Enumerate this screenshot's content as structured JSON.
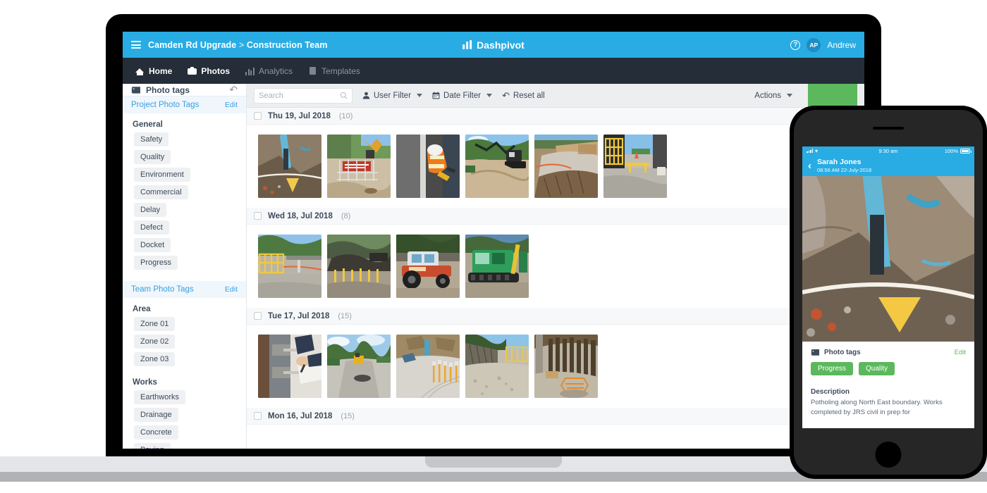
{
  "colors": {
    "brand_blue": "#28ace3",
    "nav_dark": "#242d38",
    "green": "#5cb85c",
    "link_blue": "#3b9ede",
    "text_dark": "#3d4b5c"
  },
  "desktop": {
    "topbar": {
      "menu_icon": "hamburger-icon",
      "breadcrumb_project": "Camden Rd Upgrade",
      "breadcrumb_separator": ">",
      "breadcrumb_team": "Construction Team",
      "brand": "Dashpivot",
      "help_icon": "help-icon",
      "avatar_initials": "AP",
      "user_name": "Andrew"
    },
    "nav": [
      {
        "label": "Home",
        "icon": "home-icon",
        "active": false
      },
      {
        "label": "Photos",
        "icon": "camera-icon",
        "active": true
      },
      {
        "label": "Analytics",
        "icon": "analytics-icon",
        "active": false
      },
      {
        "label": "Templates",
        "icon": "document-icon",
        "active": false
      }
    ],
    "sidebar": {
      "title": "Photo tags",
      "tag_icon": "tag-icon",
      "reset_icon": "undo-icon",
      "sections": [
        {
          "title": "Project Photo Tags",
          "edit_label": "Edit",
          "groups": [
            {
              "label": "General",
              "tags": [
                "Safety",
                "Quality",
                "Environment",
                "Commercial",
                "Delay",
                "Defect",
                "Docket",
                "Progress"
              ]
            }
          ]
        },
        {
          "title": "Team Photo Tags",
          "edit_label": "Edit",
          "groups": [
            {
              "label": "Area",
              "tags": [
                "Zone 01",
                "Zone 02",
                "Zone 03"
              ]
            },
            {
              "label": "Works",
              "tags": [
                "Earthworks",
                "Drainage",
                "Concrete",
                "Paving"
              ]
            }
          ]
        }
      ]
    },
    "toolbar": {
      "search_placeholder": "Search",
      "search_value": "",
      "search_icon": "search-icon",
      "user_filter_label": "User Filter",
      "user_filter_icon": "user-icon",
      "date_filter_label": "Date Filter",
      "date_filter_icon": "calendar-icon",
      "reset_all_label": "Reset all",
      "reset_all_icon": "undo-icon",
      "actions_label": "Actions"
    },
    "photo_groups": [
      {
        "date": "Thu 19, Jul 2018",
        "count": "(10)",
        "thumbs": [
          "trench-pipe",
          "excavator-fence",
          "worker-orange",
          "excavator-dirt",
          "road-embankment",
          "yellow-barrier"
        ]
      },
      {
        "date": "Wed 18, Jul 2018",
        "count": "(8)",
        "thumbs": [
          "yellow-fence-road",
          "stockpile-site",
          "loader-machine",
          "green-excavator"
        ]
      },
      {
        "date": "Tue 17, Jul 2018",
        "count": "(15)",
        "thumbs": [
          "desk-inspection",
          "road-paving",
          "rock-cut-site",
          "embankment-road",
          "timber-piles"
        ]
      },
      {
        "date": "Mon 16, Jul 2018",
        "count": "(15)",
        "thumbs": []
      }
    ]
  },
  "phone": {
    "status": {
      "time": "9:30 am",
      "battery": "100%",
      "signal_icon": "signal-icon",
      "wifi_icon": "wifi-icon",
      "battery_icon": "battery-icon"
    },
    "header": {
      "back_icon": "chevron-left-icon",
      "user_name": "Sarah Jones",
      "timestamp": "08:56 AM 22-July-2018"
    },
    "photo": "trench-pipe",
    "card": {
      "tag_icon": "tag-icon",
      "title": "Photo tags",
      "edit_label": "Edit",
      "tags": [
        "Progress",
        "Quality"
      ],
      "description_title": "Description",
      "description": "Potholing along North East boundary. Works completed by JRS civil in prep for"
    }
  }
}
